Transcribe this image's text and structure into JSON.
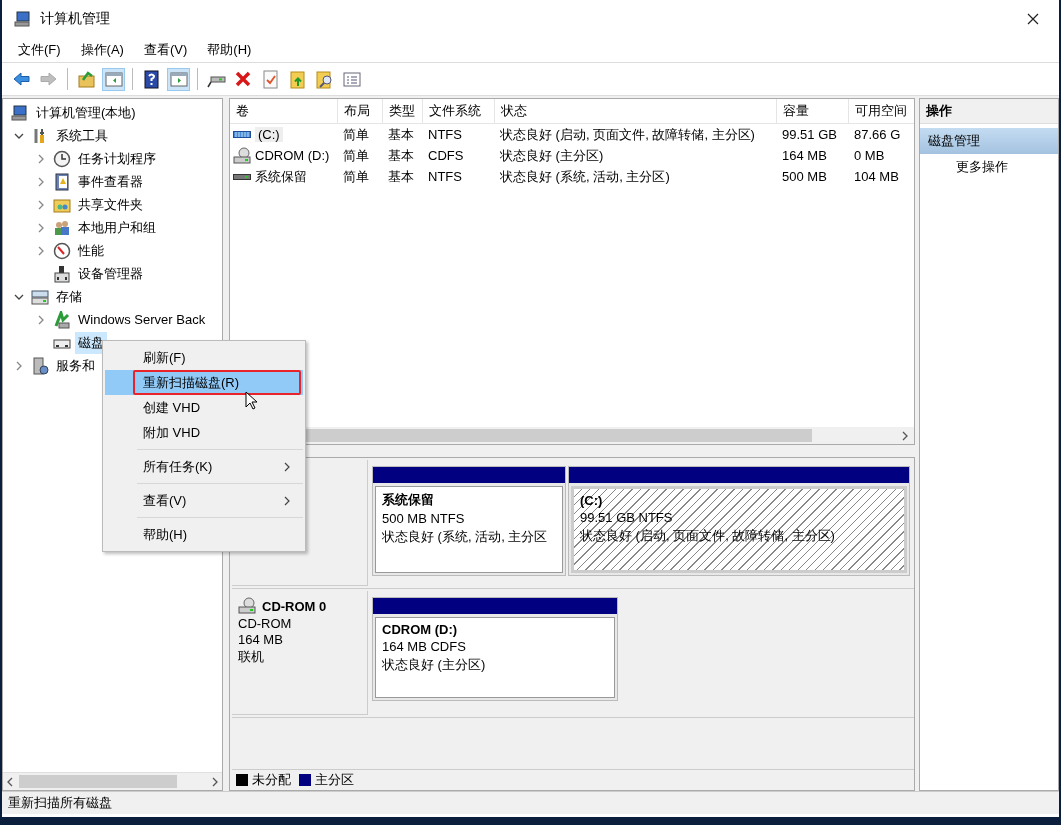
{
  "window": {
    "title": "计算机管理"
  },
  "menu_bar": [
    "文件(F)",
    "操作(A)",
    "查看(V)",
    "帮助(H)"
  ],
  "toolbar": [
    {
      "kind": "back",
      "disabled": false
    },
    {
      "kind": "forward",
      "disabled": true
    },
    {
      "kind": "sep"
    },
    {
      "kind": "up",
      "disabled": false
    },
    {
      "kind": "tree",
      "on": true
    },
    {
      "kind": "sep"
    },
    {
      "kind": "help",
      "disabled": false
    },
    {
      "kind": "actionpane",
      "on": true
    },
    {
      "kind": "sep"
    },
    {
      "kind": "connect",
      "disabled": false
    },
    {
      "kind": "delete",
      "disabled": false
    },
    {
      "kind": "props",
      "disabled": false
    },
    {
      "kind": "folder-up",
      "disabled": false
    },
    {
      "kind": "find",
      "disabled": false
    },
    {
      "kind": "list",
      "disabled": false
    }
  ],
  "tree": [
    {
      "label": "计算机管理(本地)",
      "kind": "root",
      "selected": false,
      "children": [
        {
          "label": "系统工具",
          "kind": "branch",
          "expanded": true,
          "selected": false,
          "children": [
            {
              "label": "任务计划程序",
              "kind": "branch",
              "expanded": false,
              "selected": false
            },
            {
              "label": "事件查看器",
              "kind": "branch",
              "expanded": false,
              "selected": false
            },
            {
              "label": "共享文件夹",
              "kind": "branch",
              "expanded": false,
              "selected": false
            },
            {
              "label": "本地用户和组",
              "kind": "branch",
              "expanded": false,
              "selected": false
            },
            {
              "label": "性能",
              "kind": "branch",
              "expanded": false,
              "selected": false
            },
            {
              "label": "设备管理器",
              "kind": "leaf",
              "selected": false
            }
          ]
        },
        {
          "label": "存储",
          "kind": "branch",
          "expanded": true,
          "selected": false,
          "children": [
            {
              "label": "Windows Server Back",
              "kind": "branch",
              "expanded": false,
              "selected": false
            },
            {
              "label": "磁盘",
              "kind": "leaf",
              "selected": true
            }
          ]
        },
        {
          "label": "服务和",
          "kind": "branch",
          "expanded": false,
          "selected": false
        }
      ]
    }
  ],
  "volumes": {
    "columns": [
      "卷",
      "布局",
      "类型",
      "文件系统",
      "状态",
      "容量",
      "可用空间"
    ],
    "rows": [
      {
        "cells": [
          "(C:)",
          "简单",
          "基本",
          "NTFS",
          "状态良好 (启动, 页面文件, 故障转储, 主分区)",
          "99.51 GB",
          "87.66 G"
        ],
        "selected": true
      },
      {
        "cells": [
          "CDROM (D:)",
          "简单",
          "基本",
          "CDFS",
          "状态良好 (主分区)",
          "164 MB",
          "0 MB"
        ],
        "selected": false
      },
      {
        "cells": [
          "系统保留",
          "简单",
          "基本",
          "NTFS",
          "状态良好 (系统, 活动, 主分区)",
          "500 MB",
          "104 MB"
        ],
        "selected": false
      }
    ]
  },
  "disks": [
    {
      "partitions": [
        {
          "title": "系统保留",
          "size": "500 MB NTFS",
          "status": "状态良好 (系统, 活动, 主分区",
          "selected": false,
          "color": "#000080"
        },
        {
          "title": "(C:)",
          "size": "99.51 GB NTFS",
          "status": "状态良好 (启动, 页面文件, 故障转储, 主分区)",
          "selected": true,
          "color": "#000080"
        }
      ]
    },
    {
      "name": "CD-ROM 0",
      "lines": [
        "CD-ROM",
        "164 MB",
        "联机"
      ],
      "partitions": [
        {
          "title": "CDROM  (D:)",
          "size": "164 MB CDFS",
          "status": "状态良好 (主分区)",
          "selected": false,
          "color": "#000080"
        }
      ]
    }
  ],
  "legend": [
    {
      "label": "未分配",
      "color": "#000000"
    },
    {
      "label": "主分区",
      "color": "#000080"
    }
  ],
  "actions": {
    "header": "操作",
    "section": "磁盘管理",
    "items": [
      "更多操作"
    ]
  },
  "context_menu": {
    "items": [
      {
        "kind": "item",
        "label": "刷新(F)",
        "selected": false,
        "outlined": false
      },
      {
        "kind": "item",
        "label": "重新扫描磁盘(R)",
        "selected": true,
        "outlined": true
      },
      {
        "kind": "item",
        "label": "创建 VHD",
        "selected": false,
        "outlined": false
      },
      {
        "kind": "item",
        "label": "附加 VHD",
        "selected": false,
        "outlined": false
      },
      {
        "kind": "separator"
      },
      {
        "kind": "submenu",
        "label": "所有任务(K)",
        "selected": false,
        "outlined": false
      },
      {
        "kind": "separator"
      },
      {
        "kind": "submenu",
        "label": "查看(V)",
        "selected": false,
        "outlined": false
      },
      {
        "kind": "separator"
      },
      {
        "kind": "item",
        "label": "帮助(H)",
        "selected": false,
        "outlined": false
      }
    ]
  },
  "status_bar": "重新扫描所有磁盘"
}
